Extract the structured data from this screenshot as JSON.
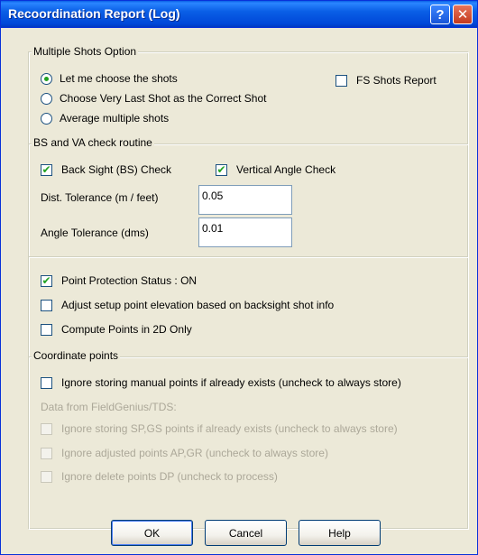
{
  "window": {
    "title": "Recoordination Report (Log)"
  },
  "multiple_shots": {
    "group_label": "Multiple Shots Option",
    "options": [
      {
        "label": "Let me choose the shots",
        "selected": true
      },
      {
        "label": "Choose Very Last Shot as the Correct Shot",
        "selected": false
      },
      {
        "label": "Average multiple shots",
        "selected": false
      }
    ],
    "fs_shots_report": {
      "label": "FS Shots Report",
      "checked": false
    }
  },
  "bs_va": {
    "group_label": "BS and VA check routine",
    "bs_check": {
      "label": "Back Sight (BS) Check",
      "checked": true
    },
    "va_check": {
      "label": "Vertical Angle Check",
      "checked": true
    },
    "dist_tolerance": {
      "label": "Dist. Tolerance (m / feet)",
      "value": "0.05"
    },
    "angle_tolerance": {
      "label": "Angle Tolerance (dms)",
      "value": "0.01"
    }
  },
  "protection": {
    "point_protection": {
      "label": "Point Protection Status :  ON",
      "checked": true
    },
    "adjust_setup": {
      "label": "Adjust setup point elevation  based on backsight shot info",
      "checked": false
    },
    "compute_2d": {
      "label": "Compute Points in 2D Only",
      "checked": false
    }
  },
  "coordinate_points": {
    "group_label": "Coordinate points",
    "ignore_manual": {
      "label": "Ignore storing manual points if already exists (uncheck to always store)",
      "checked": false
    },
    "fg_label": "Data from FieldGenius/TDS:",
    "ignore_sp_gs": {
      "label": "Ignore storing SP,GS points if already exists (uncheck to always store)",
      "checked": false,
      "disabled": true
    },
    "ignore_adjusted": {
      "label": "Ignore adjusted points AP,GR (uncheck to always store)",
      "checked": false,
      "disabled": true
    },
    "ignore_delete": {
      "label": "Ignore delete points DP (uncheck to process)",
      "checked": false,
      "disabled": true
    }
  },
  "buttons": {
    "ok": "OK",
    "cancel": "Cancel",
    "help": "Help"
  },
  "titlebar_buttons": {
    "help": "?",
    "close": "✕"
  }
}
